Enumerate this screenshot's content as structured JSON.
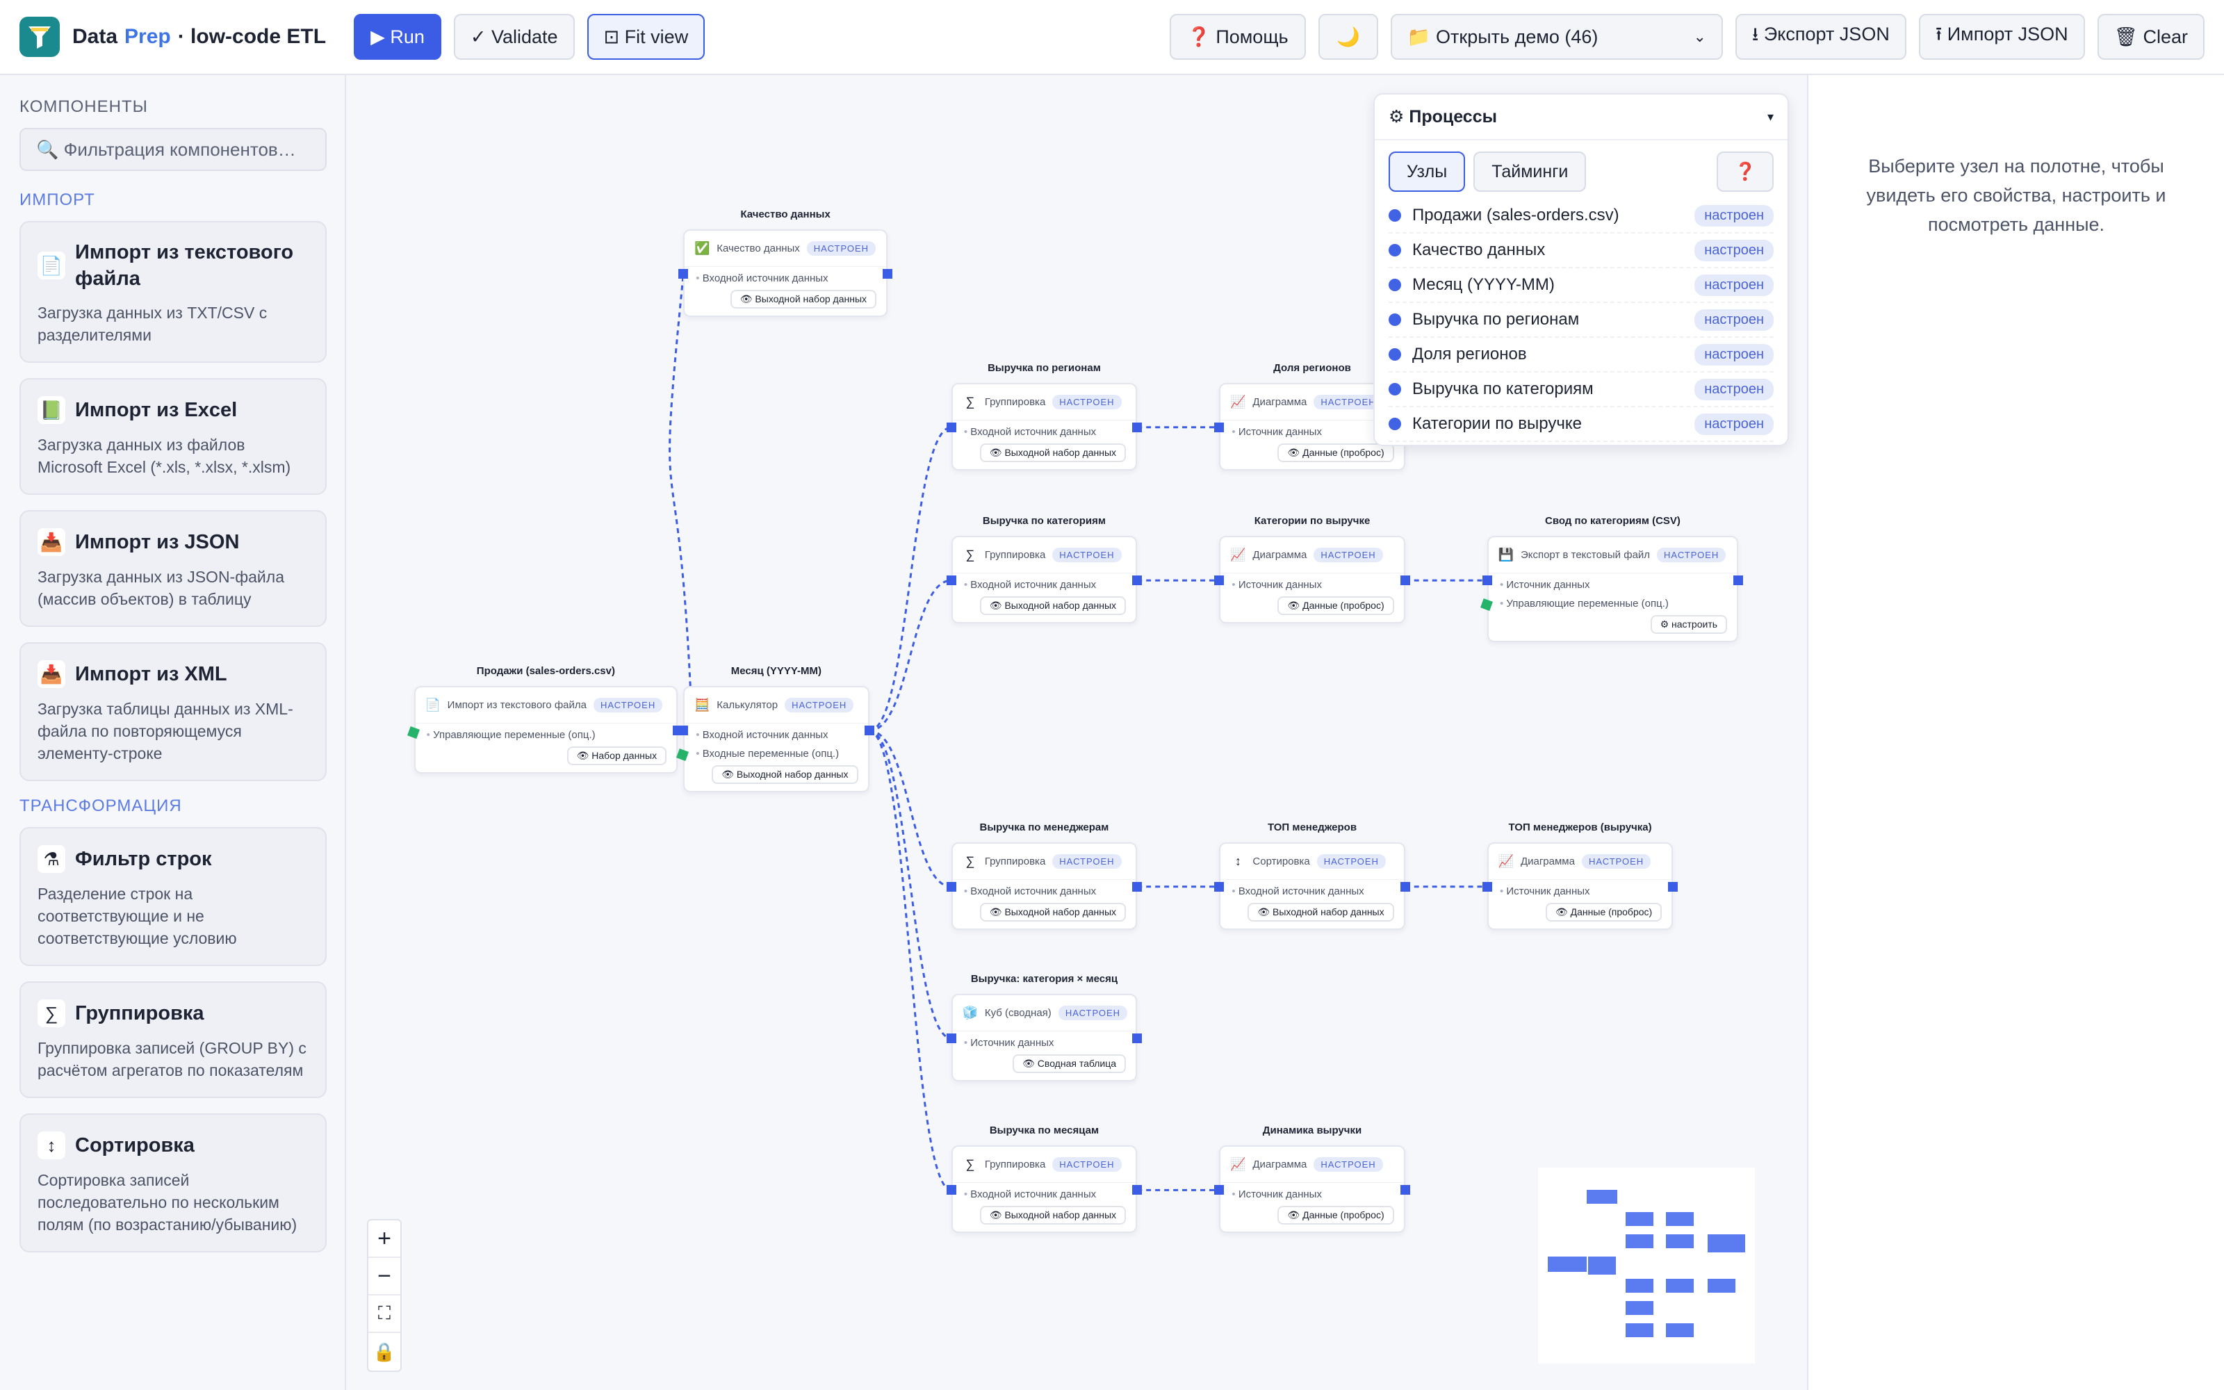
{
  "header": {
    "brand_1": "Data",
    "brand_2": "Prep",
    "brand_3": "· low-code ETL",
    "run": "▶ Run",
    "validate": "✓ Validate",
    "fit": "⊡ Fit view",
    "help": "❓ Помощь",
    "theme": "🌙",
    "demo": "📁 Открыть демо (46)",
    "export": "⭳ Экспорт JSON",
    "import": "⭱ Импорт JSON",
    "clear": "🗑 Clear"
  },
  "sidebar": {
    "title": "КОМПОНЕНТЫ",
    "filter_placeholder": "🔍 Фильтрация компонентов…",
    "sections": [
      {
        "title": "ИМПОРТ",
        "items": [
          {
            "icon": "📄",
            "title": "Импорт из текстового файла",
            "desc": "Загрузка данных из TXT/CSV с разделителями"
          },
          {
            "icon": "📗",
            "title": "Импорт из Excel",
            "desc": "Загрузка данных из файлов Microsoft Excel (*.xls, *.xlsx, *.xlsm)"
          },
          {
            "icon": "📥",
            "title": "Импорт из JSON",
            "desc": "Загрузка данных из JSON-файла (массив объектов) в таблицу"
          },
          {
            "icon": "📥",
            "title": "Импорт из XML",
            "desc": "Загрузка таблицы данных из XML-файла по повторяющемуся элементу-строке"
          }
        ]
      },
      {
        "title": "ТРАНСФОРМАЦИЯ",
        "items": [
          {
            "icon": "⚗",
            "title": "Фильтр строк",
            "desc": "Разделение строк на соответствующие и не соответствующие условию"
          },
          {
            "icon": "∑",
            "title": "Группировка",
            "desc": "Группировка записей (GROUP BY) с расчётом агрегатов по показателям"
          },
          {
            "icon": "↕",
            "title": "Сортировка",
            "desc": "Сортировка записей последовательно по нескольким полям (по возрастанию/убыванию)"
          }
        ]
      }
    ]
  },
  "canvas": {
    "badge": "НАСТРОЕН",
    "nodes": [
      {
        "label": "Качество данных",
        "icon": "✅",
        "type": "Качество данных",
        "rows": [
          "Входной источник данных"
        ],
        "out": "👁 Выходной набор данных"
      },
      {
        "label": "Продажи (sales-orders.csv)",
        "icon": "📄",
        "type": "Импорт из текстового файла",
        "rows": [
          "Управляющие переменные (опц.)"
        ],
        "out": "👁 Набор данных"
      },
      {
        "label": "Месяц (YYYY-MM)",
        "icon": "🧮",
        "type": "Калькулятор",
        "rows": [
          "Входной источник данных",
          "Входные переменные (опц.)"
        ],
        "out": "👁 Выходной набор данных"
      },
      {
        "label": "Выручка по регионам",
        "icon": "∑",
        "type": "Группировка",
        "rows": [
          "Входной источник данных"
        ],
        "out": "👁 Выходной набор данных"
      },
      {
        "label": "Доля регионов",
        "icon": "📈",
        "type": "Диаграмма",
        "rows": [
          "Источник данных"
        ],
        "out": "👁 Данные (проброс)"
      },
      {
        "label": "Выручка по категориям",
        "icon": "∑",
        "type": "Группировка",
        "rows": [
          "Входной источник данных"
        ],
        "out": "👁 Выходной набор данных"
      },
      {
        "label": "Категории по выручке",
        "icon": "📈",
        "type": "Диаграмма",
        "rows": [
          "Источник данных"
        ],
        "out": "👁 Данные (проброс)"
      },
      {
        "label": "Свод по категориям (CSV)",
        "icon": "💾",
        "type": "Экспорт в текстовый файл",
        "rows": [
          "Источник данных",
          "Управляющие переменные (опц.)"
        ],
        "out": "⚙ настроить"
      },
      {
        "label": "Выручка по менеджерам",
        "icon": "∑",
        "type": "Группировка",
        "rows": [
          "Входной источник данных"
        ],
        "out": "👁 Выходной набор данных"
      },
      {
        "label": "ТОП менеджеров",
        "icon": "↕",
        "type": "Сортировка",
        "rows": [
          "Входной источник данных"
        ],
        "out": "👁 Выходной набор данных"
      },
      {
        "label": "ТОП менеджеров (выручка)",
        "icon": "📈",
        "type": "Диаграмма",
        "rows": [
          "Источник данных"
        ],
        "out": "👁 Данные (проброс)"
      },
      {
        "label": "Выручка: категория × месяц",
        "icon": "🧊",
        "type": "Куб (сводная)",
        "rows": [
          "Источник данных"
        ],
        "out": "👁 Сводная таблица"
      },
      {
        "label": "Выручка по месяцам",
        "icon": "∑",
        "type": "Группировка",
        "rows": [
          "Входной источник данных"
        ],
        "out": "👁 Выходной набор данных"
      },
      {
        "label": "Динамика выручки",
        "icon": "📈",
        "type": "Диаграмма",
        "rows": [
          "Источник данных"
        ],
        "out": "👁 Данные (проброс)"
      }
    ],
    "zoom": [
      "+",
      "−",
      "⛶",
      "🔒"
    ]
  },
  "processes": {
    "title": "⚙ Процессы",
    "toggle": "▾",
    "tabs": [
      "Узлы",
      "Тайминги"
    ],
    "help": "❓",
    "status": "настроен",
    "items": [
      "Продажи (sales-orders.csv)",
      "Качество данных",
      "Месяц (YYYY-MM)",
      "Выручка по регионам",
      "Доля регионов",
      "Выручка по категориям",
      "Категории по выручке"
    ]
  },
  "properties": {
    "empty": "Выберите узел на полотне, чтобы увидеть его свойства, настроить и посмотреть данные."
  },
  "colors": {
    "accent": "#3b5ce4",
    "brand": "#1b8a8f",
    "port_in": "#25b36a",
    "edge": "#3b5ce4"
  }
}
